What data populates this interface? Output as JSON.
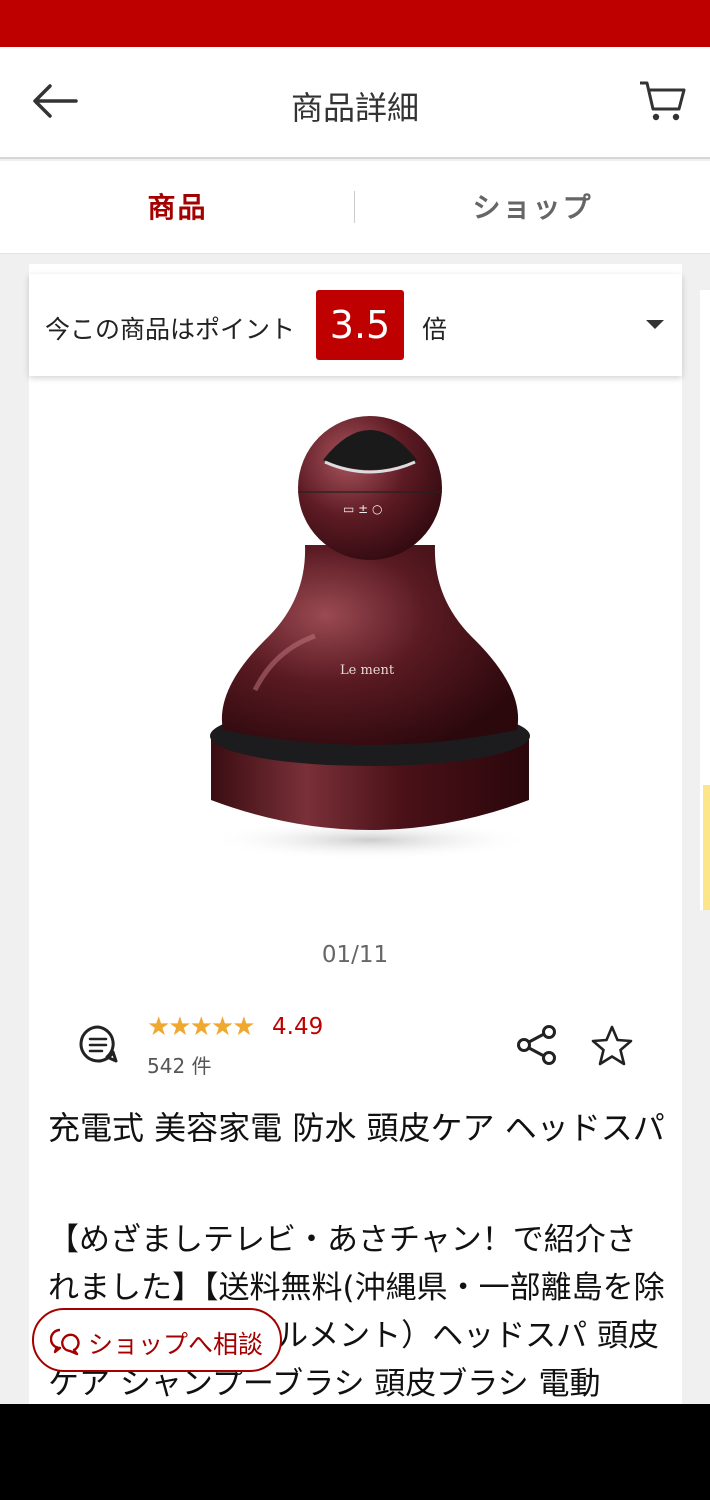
{
  "header": {
    "title": "商品詳細"
  },
  "tabs": [
    {
      "label": "商品"
    },
    {
      "label": "ショップ"
    }
  ],
  "points": {
    "prefix": "今この商品はポイント",
    "multiplier": "3.5",
    "suffix": "倍"
  },
  "product": {
    "image_text": "Le ment",
    "image_counter": "01/11",
    "stars": "★★★★★",
    "rating": "4.49",
    "rating_value": 4.49,
    "review_count": "542 件",
    "title": "充電式 美容家電 防水 頭皮ケア ヘッドスパ",
    "description": "【めざましテレビ・あさチャン！で紹介されました】【送料無料(沖縄県・一部離島を除く)】ルメント（ルメント）ヘッドスパ 頭皮ケア シャンプーブラシ 頭皮ブラシ 電動"
  },
  "consult_button": {
    "label": "ショップへ相談"
  },
  "colors": {
    "brand": "#bf0000",
    "tab_active": "#a50000",
    "star": "#f0a830"
  },
  "icons": [
    "back-arrow-icon",
    "cart-icon",
    "dropdown-triangle-icon",
    "review-chat-icon",
    "share-icon",
    "star-outline-icon",
    "chat-bubble-icon"
  ]
}
